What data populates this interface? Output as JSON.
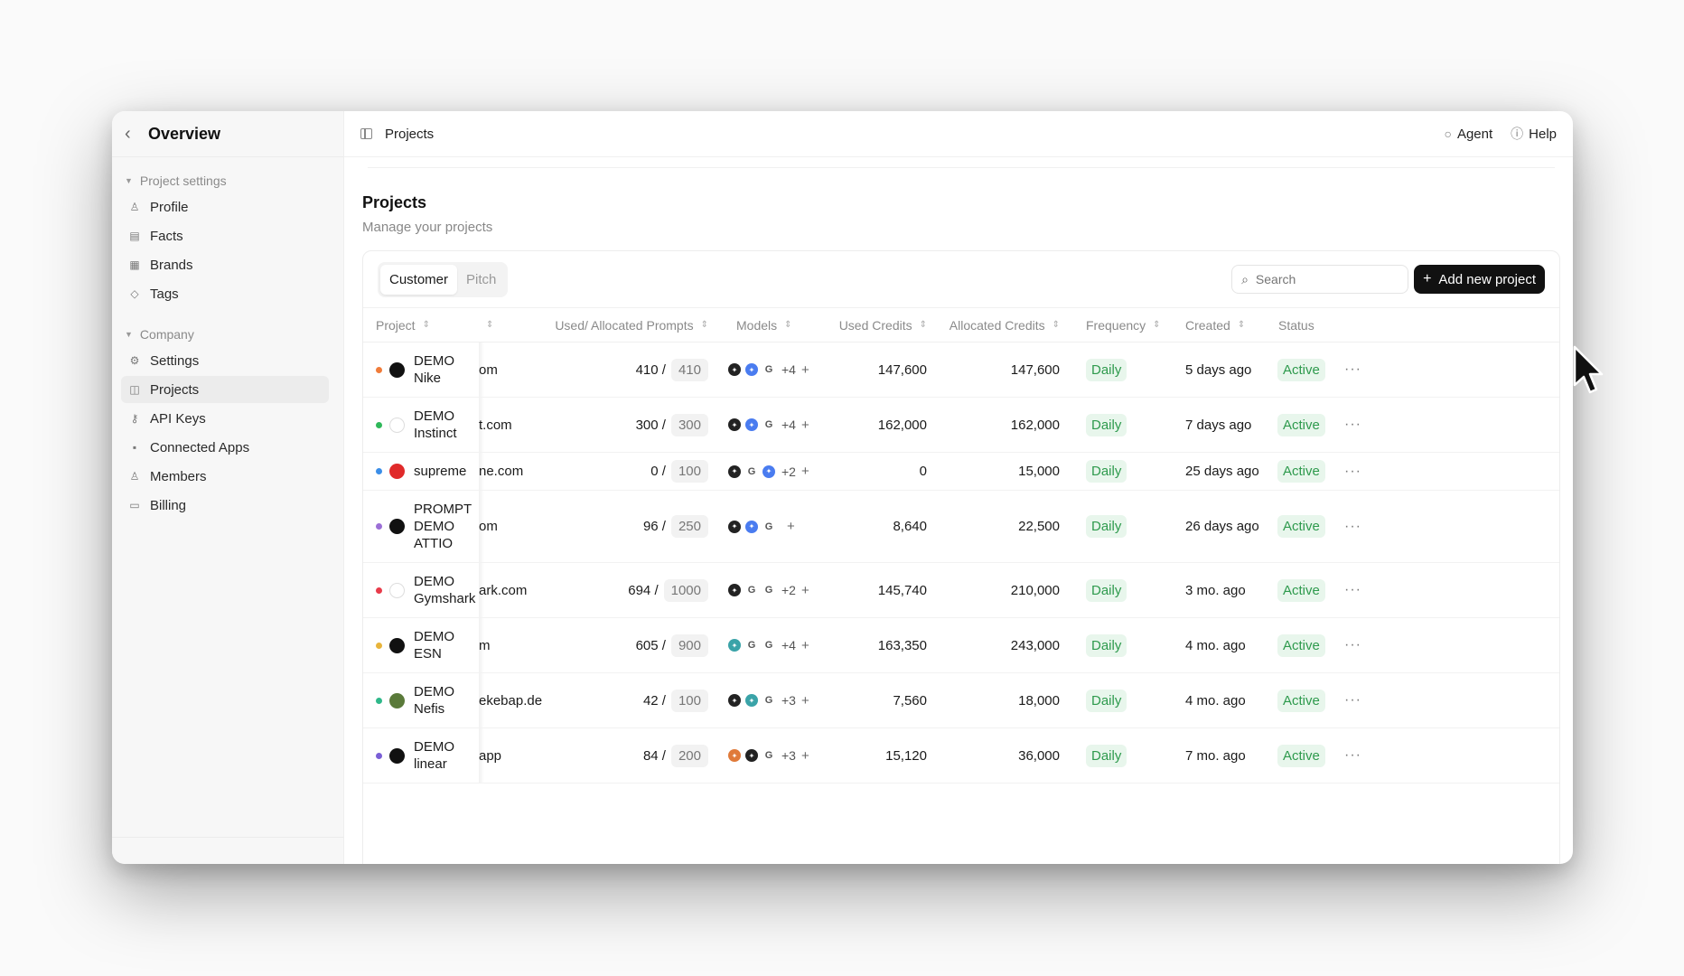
{
  "sidebar": {
    "back_icon": "chevron-left-icon",
    "title": "Overview",
    "groups": [
      {
        "label": "Project settings",
        "items": [
          {
            "label": "Profile",
            "icon": "user-icon"
          },
          {
            "label": "Facts",
            "icon": "document-icon"
          },
          {
            "label": "Brands",
            "icon": "building-icon"
          },
          {
            "label": "Tags",
            "icon": "tag-icon"
          }
        ]
      },
      {
        "label": "Company",
        "items": [
          {
            "label": "Settings",
            "icon": "gear-icon"
          },
          {
            "label": "Projects",
            "icon": "cube-icon",
            "active": true
          },
          {
            "label": "API Keys",
            "icon": "key-icon"
          },
          {
            "label": "Connected Apps",
            "icon": "grid-icon"
          },
          {
            "label": "Members",
            "icon": "users-icon"
          },
          {
            "label": "Billing",
            "icon": "card-icon"
          }
        ]
      }
    ]
  },
  "topbar": {
    "breadcrumb": "Projects",
    "agent_label": "Agent",
    "help_label": "Help"
  },
  "page": {
    "title": "Projects",
    "subtitle": "Manage your projects"
  },
  "toolbar": {
    "tabs": [
      {
        "label": "Customer",
        "active": true
      },
      {
        "label": "Pitch",
        "active": false
      }
    ],
    "search_placeholder": "Search",
    "add_label": "Add new project"
  },
  "table": {
    "columns": {
      "project": "Project",
      "domain": "",
      "prompts": "Used/ Allocated Prompts",
      "models": "Models",
      "used_credits": "Used Credits",
      "allocated_credits": "Allocated Credits",
      "frequency": "Frequency",
      "created": "Created",
      "status": "Status"
    },
    "rows": [
      {
        "name": "DEMO Nike",
        "dot": "#f07c3a",
        "logo": "#111111",
        "domain": "om",
        "used_prompts": "410 /",
        "alloc_prompts": "410",
        "models": [
          "#222222",
          "#4a7cf0",
          "G"
        ],
        "models_more": "+4",
        "used_credits": "147,600",
        "allocated_credits": "147,600",
        "frequency": "Daily",
        "created": "5 days ago",
        "status": "Active",
        "height": 61
      },
      {
        "name": "DEMO Instinct",
        "dot": "#2fb85a",
        "logo": "#ffffff",
        "domain": "t.com",
        "used_prompts": "300 /",
        "alloc_prompts": "300",
        "models": [
          "#222222",
          "#4a7cf0",
          "G"
        ],
        "models_more": "+4",
        "used_credits": "162,000",
        "allocated_credits": "162,000",
        "frequency": "Daily",
        "created": "7 days ago",
        "status": "Active",
        "height": 61
      },
      {
        "name": "supreme",
        "dot": "#3b8ee8",
        "logo": "#e02a2a",
        "domain": "ne.com",
        "used_prompts": "0 /",
        "alloc_prompts": "100",
        "models": [
          "#222222",
          "G",
          "#4a7cf0"
        ],
        "models_more": "+2",
        "used_credits": "0",
        "allocated_credits": "15,000",
        "frequency": "Daily",
        "created": "25 days ago",
        "status": "Active",
        "height": 42
      },
      {
        "name": "PROMPT DEMO ATTIO",
        "dot": "#9b6fd6",
        "logo": "#111111",
        "domain": "om",
        "used_prompts": "96 /",
        "alloc_prompts": "250",
        "models": [
          "#222222",
          "#4a7cf0",
          "G"
        ],
        "models_more": "",
        "used_credits": "8,640",
        "allocated_credits": "22,500",
        "frequency": "Daily",
        "created": "26 days ago",
        "status": "Active",
        "height": 80
      },
      {
        "name": "DEMO Gymshark",
        "dot": "#e83b4a",
        "logo": "#ffffff",
        "domain": "ark.com",
        "used_prompts": "694 /",
        "alloc_prompts": "1000",
        "models": [
          "#222222",
          "G",
          "G"
        ],
        "models_more": "+2",
        "used_credits": "145,740",
        "allocated_credits": "210,000",
        "frequency": "Daily",
        "created": "3 mo. ago",
        "status": "Active",
        "height": 61
      },
      {
        "name": "DEMO ESN",
        "dot": "#e8b43b",
        "logo": "#111111",
        "domain": "m",
        "used_prompts": "605 /",
        "alloc_prompts": "900",
        "models": [
          "#3aa3a8",
          "G",
          "G"
        ],
        "models_more": "+4",
        "used_credits": "163,350",
        "allocated_credits": "243,000",
        "frequency": "Daily",
        "created": "4 mo. ago",
        "status": "Active",
        "height": 61
      },
      {
        "name": "DEMO Nefis",
        "dot": "#2fb88a",
        "logo": "#5a7a3a",
        "domain": "ekebap.de",
        "used_prompts": "42 /",
        "alloc_prompts": "100",
        "models": [
          "#222222",
          "#3aa3a8",
          "G"
        ],
        "models_more": "+3",
        "used_credits": "7,560",
        "allocated_credits": "18,000",
        "frequency": "Daily",
        "created": "4 mo. ago",
        "status": "Active",
        "height": 61
      },
      {
        "name": "DEMO linear",
        "dot": "#7a5fd6",
        "logo": "#111111",
        "domain": "app",
        "used_prompts": "84 /",
        "alloc_prompts": "200",
        "models": [
          "#e07a3a",
          "#222222",
          "G"
        ],
        "models_more": "+3",
        "used_credits": "15,120",
        "allocated_credits": "36,000",
        "frequency": "Daily",
        "created": "7 mo. ago",
        "status": "Active",
        "height": 61
      }
    ]
  }
}
